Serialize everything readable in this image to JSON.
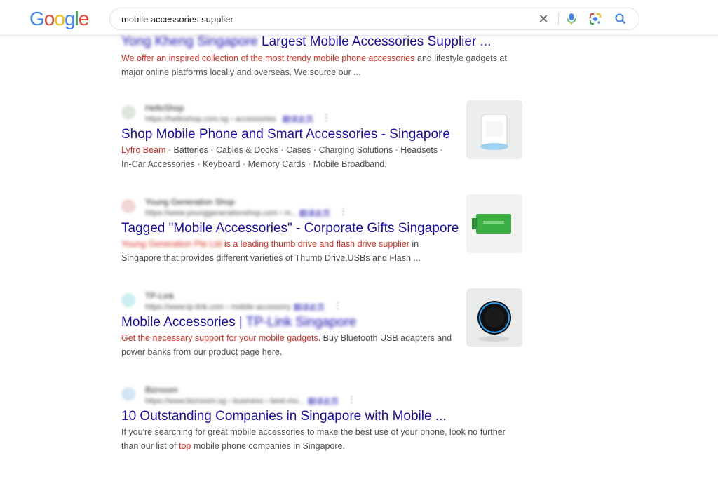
{
  "logo": "Google",
  "search": {
    "query": "mobile accessories supplier"
  },
  "results": [
    {
      "title_blurred": "Yong Kheng Singapore",
      "title": "Largest Mobile Accessories Supplier ...",
      "snippet_hl": "We offer an inspired collection of the most trendy mobile phone accessories",
      "snippet_rest": " and lifestyle gadgets at major online platforms locally and overseas. We source our ..."
    },
    {
      "site_name": "HelloShop",
      "site_url": "https://helloshop.com.sg › accessories",
      "site_extra": "翻译此页",
      "title": "Shop Mobile Phone and Smart Accessories - Singapore",
      "snippet_hl": "Lyfro Beam",
      "snippet_rest": " · Batteries · Cables & Docks · Cases · Charging Solutions · Headsets · In-Car Accessories · Keyboard · Memory Cards · Mobile Broadband."
    },
    {
      "site_name": "Young Generation Shop",
      "site_url": "https://www.younggenerationshop.com › m...",
      "site_extra": "翻译此页",
      "title": "Tagged \"Mobile Accessories\" - Corporate Gifts Singapore",
      "snippet_blur": "Young Generation Pte Ltd",
      "snippet_hl": " is a leading thumb drive and flash drive supplier",
      "snippet_rest": " in Singapore that provides different varieties of Thumb Drive,USBs and Flash ..."
    },
    {
      "site_name": "TP-Link",
      "site_url": "https://www.tp-link.com › mobile-accessory",
      "site_extra": "翻译此页",
      "title": "Mobile Accessories | ",
      "title_blurred": "TP-Link Singapore",
      "snippet_hl": "Get the necessary support for your mobile gadgets.",
      "snippet_rest": " Buy Bluetooth USB adapters and power banks from our product page here."
    },
    {
      "site_name": "Biznoom",
      "site_url": "https://www.biznoom.sg › business › best-mo...",
      "site_extra": "翻译此页",
      "title": "10 Outstanding Companies in Singapore with Mobile ...",
      "snippet_pre": "If you're searching for great mobile accessories to make the best use of your phone, look no further than our list of ",
      "snippet_hl": "top",
      "snippet_rest": " mobile phone companies in Singapore."
    }
  ],
  "icons": {
    "clear": "close-icon",
    "mic": "microphone-icon",
    "lens": "google-lens-icon",
    "search": "search-icon"
  },
  "colors": {
    "link": "#1a0dab",
    "highlight": "#d93025",
    "snippet": "#4d5156"
  }
}
